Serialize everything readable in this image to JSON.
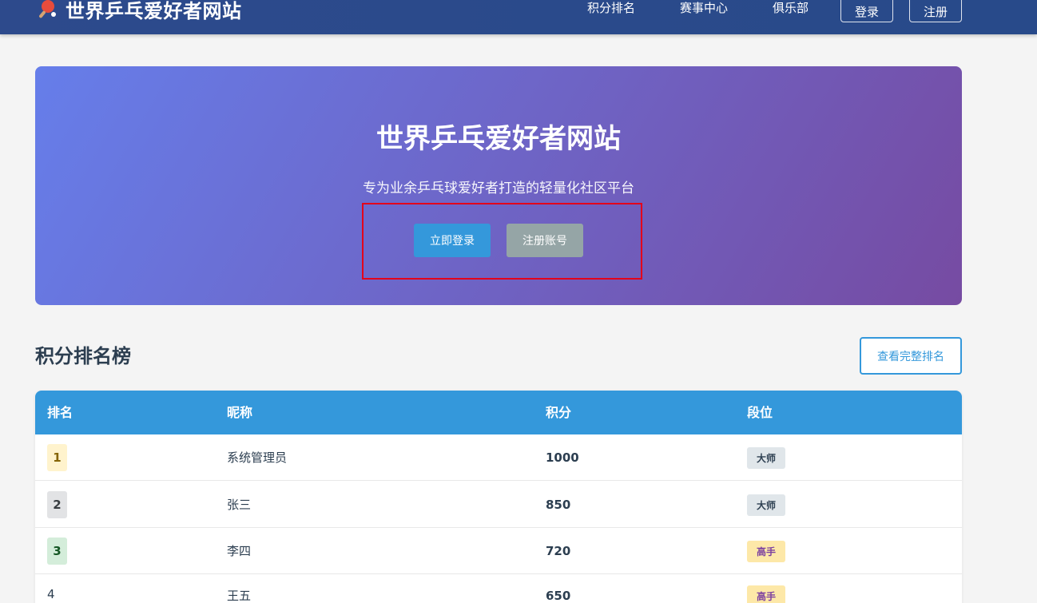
{
  "nav": {
    "brand_title": "世界乒乓爱好者网站",
    "links": [
      "积分排名",
      "赛事中心",
      "俱乐部"
    ],
    "login_label": "登录",
    "register_label": "注册"
  },
  "hero": {
    "title": "世界乒乓爱好者网站",
    "subtitle": "专为业余乒乓球爱好者打造的轻量化社区平台",
    "login_button": "立即登录",
    "register_button": "注册账号"
  },
  "ranking": {
    "title": "积分排名榜",
    "view_all_label": "查看完整排名",
    "columns": [
      "排名",
      "昵称",
      "积分",
      "段位"
    ],
    "rows": [
      {
        "rank": "1",
        "nickname": "系统管理员",
        "score": "1000",
        "level": "大师"
      },
      {
        "rank": "2",
        "nickname": "张三",
        "score": "850",
        "level": "大师"
      },
      {
        "rank": "3",
        "nickname": "李四",
        "score": "720",
        "level": "高手"
      },
      {
        "rank": "4",
        "nickname": "王五",
        "score": "650",
        "level": "高手"
      }
    ]
  },
  "colors": {
    "nav_bg": "#2d4a8c",
    "hero_start": "#667eea",
    "hero_end": "#764ba2",
    "primary": "#3498db",
    "secondary": "#95a5a6",
    "highlight": "#e3001b"
  }
}
